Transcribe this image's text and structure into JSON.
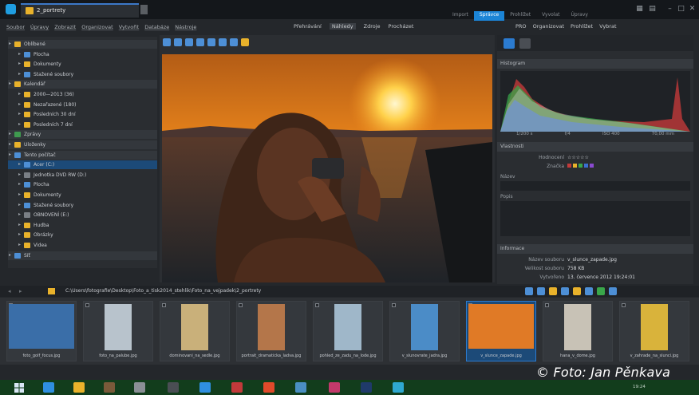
{
  "window": {
    "tab_title": "2_portrety",
    "modes": [
      "Import",
      "Správce",
      "Prohlížet",
      "Vyvolat",
      "Úpravy"
    ],
    "active_mode": "Správce"
  },
  "menu": {
    "items": [
      "Soubor",
      "Úpravy",
      "Zobrazit",
      "Organizovat",
      "Vytvořit",
      "Databáze",
      "Nástroje"
    ],
    "right_items": [
      "Přehrávání",
      "Náhledy",
      "Zdroje",
      "Procházet"
    ],
    "far_items": [
      "PRO",
      "Organizovat",
      "Prohlížet",
      "Vybrat"
    ]
  },
  "tree": {
    "rows": [
      {
        "label": "Oblíbené",
        "level": 0,
        "kind": "hdr",
        "color": "#e9b22b"
      },
      {
        "label": "Plocha",
        "level": 1,
        "color": "#4d8fd6"
      },
      {
        "label": "Dokumenty",
        "level": 1,
        "color": "#e9b22b"
      },
      {
        "label": "Stažené soubory",
        "level": 1,
        "color": "#4d8fd6"
      },
      {
        "label": "Kalendář",
        "level": 0,
        "kind": "hdr",
        "color": "#e9b22b"
      },
      {
        "label": "2000—2013 (36)",
        "level": 1,
        "color": "#e9b22b"
      },
      {
        "label": "Nezařazené (180)",
        "level": 1,
        "color": "#e9b22b"
      },
      {
        "label": "Posledních 30 dní",
        "level": 1,
        "color": "#e9b22b"
      },
      {
        "label": "Posledních 7 dní",
        "level": 1,
        "color": "#e9b22b"
      },
      {
        "label": "Zprávy",
        "level": 0,
        "kind": "hdr",
        "color": "#3f9a4f"
      },
      {
        "label": "Uloženky",
        "level": 0,
        "kind": "hdr",
        "color": "#e9b22b"
      },
      {
        "label": "Tento počítač",
        "level": 0,
        "kind": "hdr",
        "color": "#4d8fd6"
      },
      {
        "label": "Acer (C:)",
        "level": 1,
        "kind": "sel",
        "color": "#4d8fd6"
      },
      {
        "label": "Jednotka DVD RW (D:)",
        "level": 1,
        "color": "#7a7f85"
      },
      {
        "label": "Plocha",
        "level": 1,
        "color": "#4d8fd6"
      },
      {
        "label": "Dokumenty",
        "level": 1,
        "color": "#e9b22b"
      },
      {
        "label": "Stažené soubory",
        "level": 1,
        "color": "#4d8fd6"
      },
      {
        "label": "OBNOVENÍ (E:)",
        "level": 1,
        "color": "#7a7f85"
      },
      {
        "label": "Hudba",
        "level": 1,
        "color": "#e9b22b"
      },
      {
        "label": "Obrázky",
        "level": 1,
        "color": "#e9b22b"
      },
      {
        "label": "Videa",
        "level": 1,
        "color": "#e9b22b"
      },
      {
        "label": "Síť",
        "level": 0,
        "kind": "hdr",
        "color": "#4d8fd6"
      }
    ]
  },
  "right_panel": {
    "histogram_title": "Histogram",
    "histogram_axis": [
      "1/200 s",
      "f/4",
      "ISO 400",
      "70,00 mm"
    ],
    "section_props": "Vlastnosti",
    "props": [
      {
        "key": "Hodnocení",
        "value": "☆☆☆☆☆"
      },
      {
        "key": "Značka",
        "value": ""
      }
    ],
    "label_title": "Název",
    "label_popis": "Popis",
    "section_info": "Informace",
    "info": [
      {
        "key": "Název souboru",
        "value": "v_slunce_zapade.jpg"
      },
      {
        "key": "Velikost souboru",
        "value": "758 KB"
      },
      {
        "key": "Vytvořeno",
        "value": "13. července 2012 19:24:01"
      }
    ]
  },
  "addressbar": {
    "path": "C:\\Users\\fotografie\\Desktop\\Foto_a_tisk2014_stehlik\\Foto_na_vejpadek\\2_portrety"
  },
  "filmstrip": {
    "items": [
      {
        "caption": "foto_golf_focus.jpg",
        "color": "#3a6ea8"
      },
      {
        "caption": "foto_na_palube.jpg",
        "color": "#b8c3cc"
      },
      {
        "caption": "dominovani_na_sedle.jpg",
        "color": "#c9b07a"
      },
      {
        "caption": "portrait_dramaticka_ladva.jpg",
        "color": "#b4764a"
      },
      {
        "caption": "pohled_ze_zadu_na_lode.jpg",
        "color": "#9fb7c9"
      },
      {
        "caption": "v_slunovrate_jadra.jpg",
        "color": "#4b8cc7"
      },
      {
        "caption": "v_slunce_zapade.jpg",
        "color": "#e07a26",
        "selected": true
      },
      {
        "caption": "hana_v_dome.jpg",
        "color": "#c8c2b6"
      },
      {
        "caption": "v_zahrade_na_slunci.jpg",
        "color": "#d9b33b"
      }
    ]
  },
  "watermark": "© Foto: Jan Pěnkava",
  "taskbar": {
    "clock": "19:24"
  },
  "colors": {
    "accent": "#1b84d6",
    "selection": "#1c4a78",
    "taskbar": "#123d1c"
  }
}
